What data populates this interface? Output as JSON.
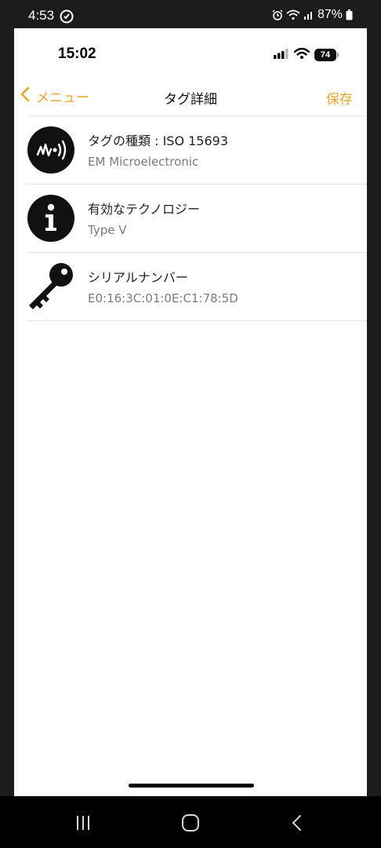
{
  "android_status": {
    "time": "4:53",
    "battery_percent": "87%",
    "icons": [
      "notification-icon",
      "alarm-icon",
      "wifi-icon",
      "cell-signal-icon",
      "battery-icon"
    ]
  },
  "ios_status": {
    "time": "15:02",
    "battery_level": "74"
  },
  "navbar": {
    "back_label": "メニュー",
    "title": "タグ詳細",
    "save_label": "保存",
    "accent_color": "#e9a52a"
  },
  "rows": [
    {
      "icon": "nfc-wave-icon",
      "title": "タグの種類 : ISO 15693",
      "subtitle": "EM Microelectronic"
    },
    {
      "icon": "info-icon",
      "title": "有効なテクノロジー",
      "subtitle": "Type V"
    },
    {
      "icon": "key-icon",
      "title": "シリアルナンバー",
      "subtitle": "E0:16:3C:01:0E:C1:78:5D"
    }
  ],
  "android_nav": {
    "buttons": [
      "recent-apps-icon",
      "home-icon",
      "back-icon"
    ]
  }
}
